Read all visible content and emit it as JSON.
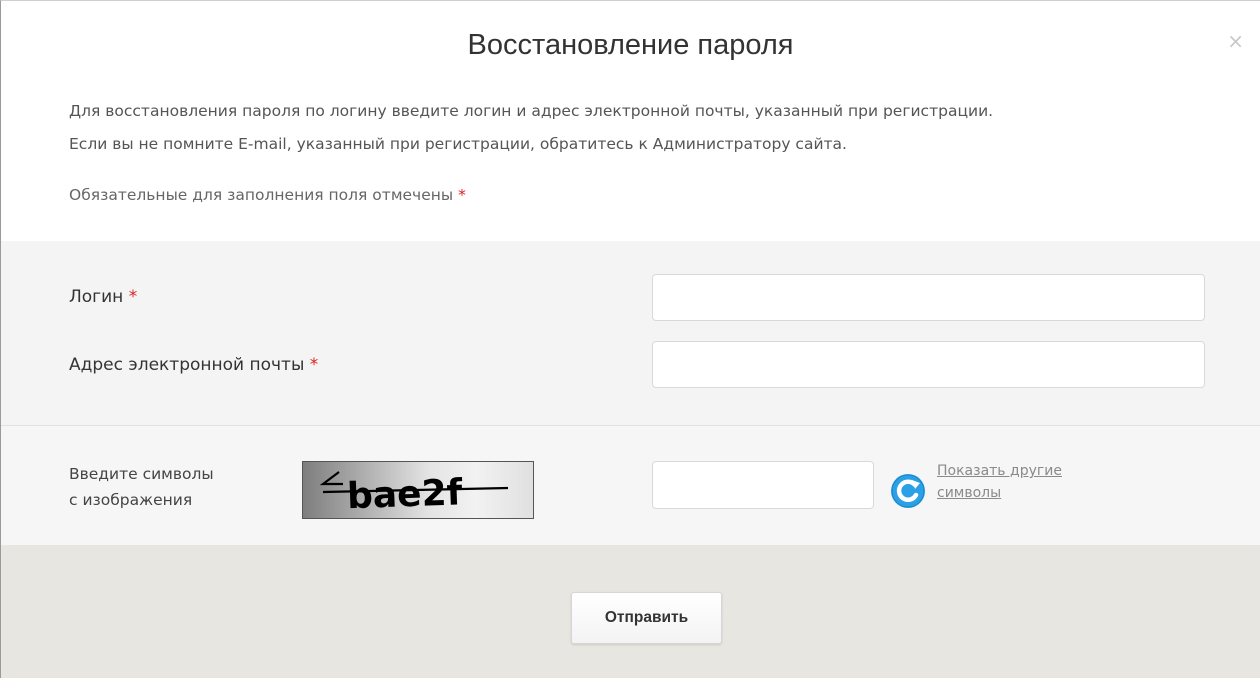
{
  "dialog": {
    "title": "Восстановление пароля",
    "close_label": "×",
    "intro_line1": "Для восстановления пароля по логину введите логин и адрес электронной почты, указанный при регистрации.",
    "intro_line2": "Если вы не помните E-mail, указанный при регистрации, обратитесь к Администратору сайта.",
    "required_note": "Обязательные для заполнения поля отмечены",
    "required_mark": "*"
  },
  "fields": {
    "login_label": "Логин",
    "login_value": "",
    "email_label": "Адрес электронной почты",
    "email_value": ""
  },
  "captcha": {
    "label_line1": "Введите символы",
    "label_line2": "с изображения",
    "image_text": "bae2f",
    "input_value": "",
    "refresh_line1": "Показать другие",
    "refresh_line2": "символы",
    "refresh_icon": "refresh-icon"
  },
  "footer": {
    "submit_label": "Отправить"
  },
  "colors": {
    "required": "#e02020",
    "refresh_icon": "#2aa0e6",
    "footer_bg": "#e8e6e1"
  }
}
